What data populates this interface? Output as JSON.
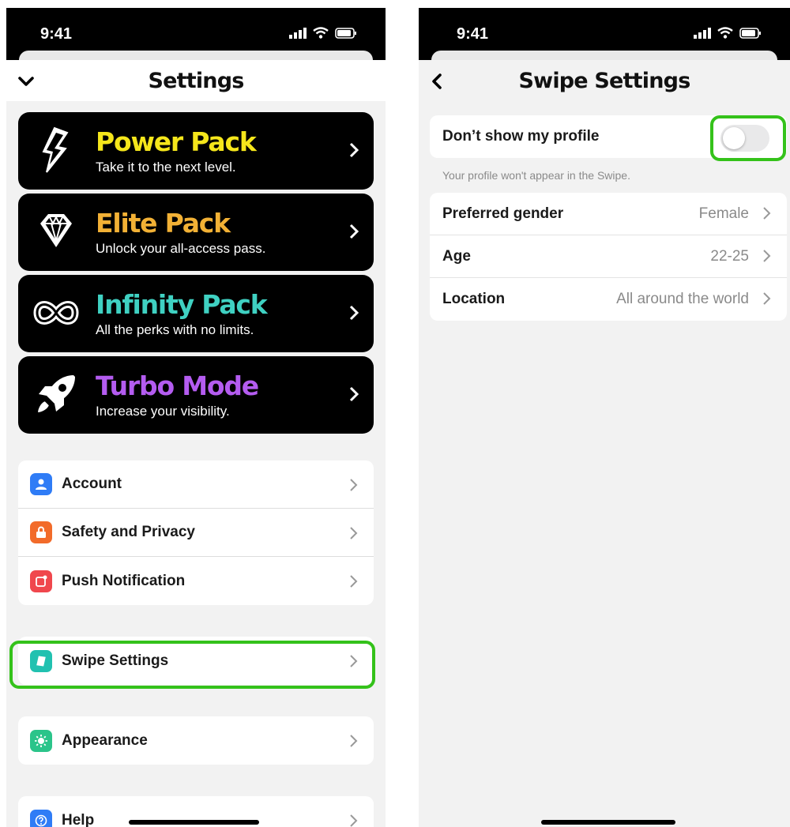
{
  "left_screen": {
    "status": {
      "time": "9:41"
    },
    "title": "Settings",
    "packs": [
      {
        "name": "Power Pack",
        "subtitle": "Take it to the next level.",
        "color": "#f5e61b",
        "icon": "lightning-icon"
      },
      {
        "name": "Elite Pack",
        "subtitle": "Unlock your all-access pass.",
        "color": "#f2b135",
        "icon": "diamond-icon"
      },
      {
        "name": "Infinity Pack",
        "subtitle": "All the perks with no limits.",
        "color": "#3fd1c2",
        "icon": "infinity-icon"
      },
      {
        "name": "Turbo Mode",
        "subtitle": "Increase your visibility.",
        "color": "#b45cf0",
        "icon": "rocket-icon"
      }
    ],
    "group1": [
      {
        "label": "Account",
        "icon": "person-icon",
        "color": "#2f7cf6"
      },
      {
        "label": "Safety and Privacy",
        "icon": "lock-icon",
        "color": "#f26b2a"
      },
      {
        "label": "Push Notification",
        "icon": "notification-icon",
        "color": "#f0474d"
      }
    ],
    "swipe": {
      "label": "Swipe Settings",
      "icon": "card-icon",
      "color": "#21c1b0"
    },
    "appearance": {
      "label": "Appearance",
      "icon": "sun-icon",
      "color": "#2bc48a"
    },
    "help": {
      "label": "Help",
      "icon": "question-icon",
      "color": "#2f7cf6"
    }
  },
  "right_screen": {
    "status": {
      "time": "9:41"
    },
    "title": "Swipe Settings",
    "hide_profile": {
      "label": "Don’t show my profile",
      "enabled": false
    },
    "note": "Your profile won't appear in the Swipe.",
    "rows": [
      {
        "label": "Preferred gender",
        "value": "Female"
      },
      {
        "label": "Age",
        "value": "22-25"
      },
      {
        "label": "Location",
        "value": "All around the world"
      }
    ]
  },
  "highlight_color": "#34c21a"
}
